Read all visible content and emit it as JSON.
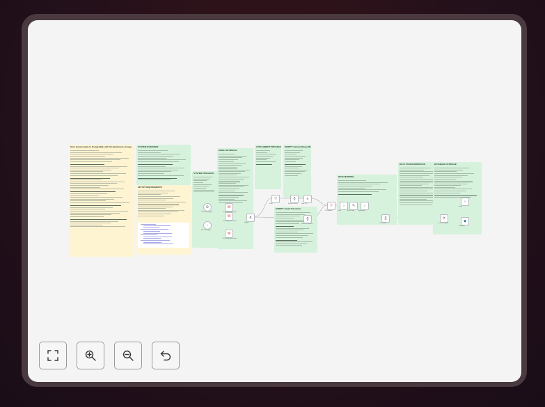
{
  "workflow": {
    "notes": [
      {
        "id": "overview",
        "color": "yellow",
        "title": "Sync Gmail emails to PostgreSQL with S3 attachment storage",
        "lines": 40
      },
      {
        "id": "system-overview",
        "color": "green",
        "title": "SYSTEM OVERVIEW",
        "lines": 16
      },
      {
        "id": "setup",
        "color": "yellow",
        "title": "SETUP REQUIREMENTS",
        "lines": 14
      },
      {
        "id": "triggers",
        "color": "green",
        "title": "SYSTEM TRIGGERS",
        "lines": 8
      },
      {
        "id": "email-retrieval",
        "color": "green",
        "title": "EMAIL RETRIEVAL",
        "lines": 26
      },
      {
        "id": "attachment",
        "color": "green",
        "title": "ATTACHMENT PROCESSING",
        "lines": 8
      },
      {
        "id": "binary",
        "color": "green",
        "title": "SCRIPT: Extract Binary Metadata",
        "lines": 14
      },
      {
        "id": "gmail-transform",
        "color": "green",
        "title": "SCRIPT: Gmail Transform",
        "lines": 18
      },
      {
        "id": "data-mapping",
        "color": "green",
        "title": "DATA MAPPING",
        "lines": 8
      },
      {
        "id": "transformation",
        "color": "green",
        "title": "DATA TRANSFORMATION",
        "lines": 20
      },
      {
        "id": "db-storage",
        "color": "green",
        "title": "DATABASE STORAGE",
        "lines": 16
      }
    ],
    "nodes": [
      {
        "id": "schedule",
        "icon": "clock-icon",
        "glyph": "⏲",
        "label": "Schedule Trigger"
      },
      {
        "id": "manual",
        "icon": "cursor-icon",
        "glyph": "◌",
        "label": "Manual Trigger"
      },
      {
        "id": "gmail-1",
        "icon": "gmail-icon",
        "glyph": "M",
        "label": "Get many messages"
      },
      {
        "id": "gmail-2",
        "icon": "gmail-icon",
        "glyph": "M",
        "label": "Get many messages"
      },
      {
        "id": "gmail-3",
        "icon": "gmail-icon",
        "glyph": "M",
        "label": "Get many messages"
      },
      {
        "id": "merge",
        "icon": "merge-icon",
        "glyph": "⋔",
        "label": "Merge"
      },
      {
        "id": "filter",
        "icon": "filter-icon",
        "glyph": "▽",
        "label": "Filter"
      },
      {
        "id": "code-1",
        "icon": "code-icon",
        "glyph": "{}",
        "label": "Extract Binary"
      },
      {
        "id": "code-2",
        "icon": "code-icon",
        "glyph": "{}",
        "label": "Gmail Transform"
      },
      {
        "id": "split",
        "icon": "split-icon",
        "glyph": "≡",
        "label": "Split Out"
      },
      {
        "id": "s3",
        "icon": "bucket-icon",
        "glyph": "▽",
        "label": "S3 Upload"
      },
      {
        "id": "loop",
        "icon": "arrow-icon",
        "glyph": "›",
        "label": "Loop"
      },
      {
        "id": "set",
        "icon": "pencil-icon",
        "glyph": "✎",
        "label": "Edit Fields"
      },
      {
        "id": "aggregate",
        "icon": "arrow-icon",
        "glyph": "›",
        "label": "Aggregate"
      },
      {
        "id": "code-3",
        "icon": "code-icon",
        "glyph": "{}",
        "label": "Transform"
      },
      {
        "id": "postgres",
        "icon": "refresh-icon",
        "glyph": "⟳",
        "label": "Insert or update"
      },
      {
        "id": "noop",
        "icon": "arrow-icon",
        "glyph": "›",
        "label": "Done"
      },
      {
        "id": "elephant",
        "icon": "postgres-icon",
        "glyph": "◆",
        "label": "Postgres"
      }
    ]
  },
  "controls": {
    "fit": "fit-view-icon",
    "zoom_in": "zoom-in-icon",
    "zoom_out": "zoom-out-icon",
    "undo": "undo-icon"
  }
}
